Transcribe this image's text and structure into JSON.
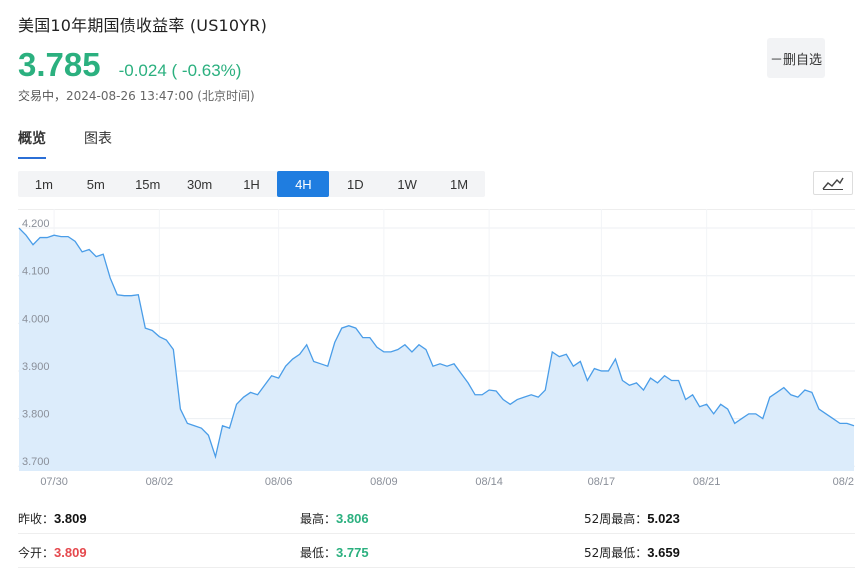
{
  "header": {
    "title": "美国10年期国债收益率  (US10YR)",
    "price": "3.785",
    "change": "-0.024 ( -0.63%)",
    "status_label": "交易中，",
    "timestamp": "2024-08-26 13:47:00 (北京时间)",
    "favorite_button": "－删自选",
    "accent_color": "#2bb07f"
  },
  "tabs": [
    {
      "label": "概览",
      "active": true
    },
    {
      "label": "图表",
      "active": false
    }
  ],
  "periods": [
    {
      "label": "1m"
    },
    {
      "label": "5m"
    },
    {
      "label": "15m"
    },
    {
      "label": "30m"
    },
    {
      "label": "1H"
    },
    {
      "label": "4H",
      "active": true
    },
    {
      "label": "1D"
    },
    {
      "label": "1W"
    },
    {
      "label": "1M"
    }
  ],
  "chart_type_icon": "line-chart-icon",
  "chart_data": {
    "type": "area",
    "ylim": [
      3.69,
      4.24
    ],
    "yticks": [
      "4.200",
      "4.100",
      "4.000",
      "3.900",
      "3.800",
      "3.700"
    ],
    "ytick_values": [
      4.2,
      4.1,
      4.0,
      3.9,
      3.8,
      3.7
    ],
    "xticks": [
      "07/30",
      "08/02",
      "08/06",
      "08/09",
      "08/14",
      "08/17",
      "08/21",
      "08/2"
    ],
    "xtick_index": [
      5,
      20,
      37,
      52,
      67,
      83,
      98,
      113
    ],
    "line_color": "#4a9de8",
    "fill_color": "#dcecfb",
    "values": [
      4.2,
      4.185,
      4.165,
      4.18,
      4.18,
      4.185,
      4.182,
      4.182,
      4.172,
      4.15,
      4.155,
      4.14,
      4.145,
      4.095,
      4.06,
      4.058,
      4.058,
      4.06,
      3.99,
      3.985,
      3.972,
      3.965,
      3.945,
      3.82,
      3.79,
      3.785,
      3.78,
      3.765,
      3.72,
      3.785,
      3.78,
      3.83,
      3.845,
      3.855,
      3.85,
      3.87,
      3.89,
      3.885,
      3.91,
      3.925,
      3.935,
      3.955,
      3.92,
      3.915,
      3.91,
      3.96,
      3.99,
      3.995,
      3.99,
      3.97,
      3.97,
      3.95,
      3.94,
      3.94,
      3.945,
      3.955,
      3.94,
      3.955,
      3.945,
      3.91,
      3.915,
      3.91,
      3.915,
      3.895,
      3.875,
      3.85,
      3.85,
      3.86,
      3.858,
      3.84,
      3.83,
      3.84,
      3.845,
      3.85,
      3.845,
      3.86,
      3.94,
      3.93,
      3.935,
      3.91,
      3.92,
      3.88,
      3.905,
      3.9,
      3.9,
      3.925,
      3.88,
      3.87,
      3.875,
      3.86,
      3.885,
      3.875,
      3.89,
      3.88,
      3.88,
      3.84,
      3.85,
      3.825,
      3.83,
      3.81,
      3.83,
      3.82,
      3.79,
      3.8,
      3.81,
      3.81,
      3.8,
      3.845,
      3.855,
      3.865,
      3.85,
      3.845,
      3.86,
      3.855,
      3.82,
      3.81,
      3.8,
      3.79,
      3.79,
      3.785
    ]
  },
  "stats": [
    [
      {
        "label": "昨收：",
        "value": "3.809",
        "color": "black"
      },
      {
        "label": "最高：",
        "value": "3.806",
        "color": "green"
      },
      {
        "label": "52周最高：",
        "value": "5.023",
        "color": "black"
      }
    ],
    [
      {
        "label": "今开：",
        "value": "3.809",
        "color": "red"
      },
      {
        "label": "最低：",
        "value": "3.775",
        "color": "green"
      },
      {
        "label": "52周最低：",
        "value": "3.659",
        "color": "black"
      }
    ]
  ]
}
